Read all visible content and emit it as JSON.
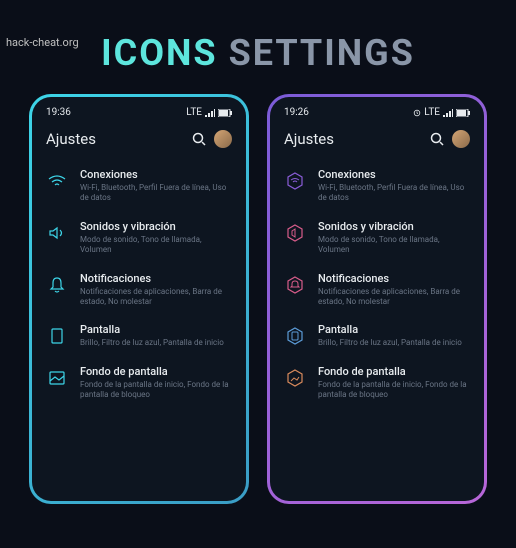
{
  "watermark": "hack-cheat.org",
  "title_accent": "ICONS",
  "title_muted": "SETTINGS",
  "phones": [
    {
      "theme": "cyan",
      "time": "19:36",
      "net_label": "LTE",
      "header": "Ajustes",
      "colors": {
        "icon": "#3dd5e8"
      },
      "items": [
        {
          "icon": "wifi",
          "title": "Conexiones",
          "sub": "Wi-Fi, Bluetooth, Perfil Fuera de línea, Uso de datos"
        },
        {
          "icon": "sound",
          "title": "Sonidos y vibración",
          "sub": "Modo de sonido, Tono de llamada, Volumen"
        },
        {
          "icon": "bell",
          "title": "Notificaciones",
          "sub": "Notificaciones de aplicaciones, Barra de estado, No molestar"
        },
        {
          "icon": "display",
          "title": "Pantalla",
          "sub": "Brillo, Filtro de luz azul, Pantalla de inicio"
        },
        {
          "icon": "wallpaper",
          "title": "Fondo de pantalla",
          "sub": "Fondo de la pantalla de inicio, Fondo de la pantalla de bloqueo"
        }
      ]
    },
    {
      "theme": "purple",
      "time": "19:26",
      "net_label": "LTE",
      "header": "Ajustes",
      "colors": {
        "icon": "multi"
      },
      "items": [
        {
          "icon": "wifi",
          "color": "#8a5cd8",
          "title": "Conexiones",
          "sub": "Wi-Fi, Bluetooth, Perfil Fuera de línea, Uso de datos"
        },
        {
          "icon": "sound",
          "color": "#d85c8a",
          "title": "Sonidos y vibración",
          "sub": "Modo de sonido, Tono de llamada, Volumen"
        },
        {
          "icon": "bell",
          "color": "#d85c8a",
          "title": "Notificaciones",
          "sub": "Notificaciones de aplicaciones, Barra de estado, No molestar"
        },
        {
          "icon": "display",
          "color": "#5c9cd8",
          "title": "Pantalla",
          "sub": "Brillo, Filtro de luz azul, Pantalla de inicio"
        },
        {
          "icon": "wallpaper",
          "color": "#d88a5c",
          "title": "Fondo de pantalla",
          "sub": "Fondo de la pantalla de inicio, Fondo de la pantalla de bloqueo"
        }
      ]
    }
  ]
}
